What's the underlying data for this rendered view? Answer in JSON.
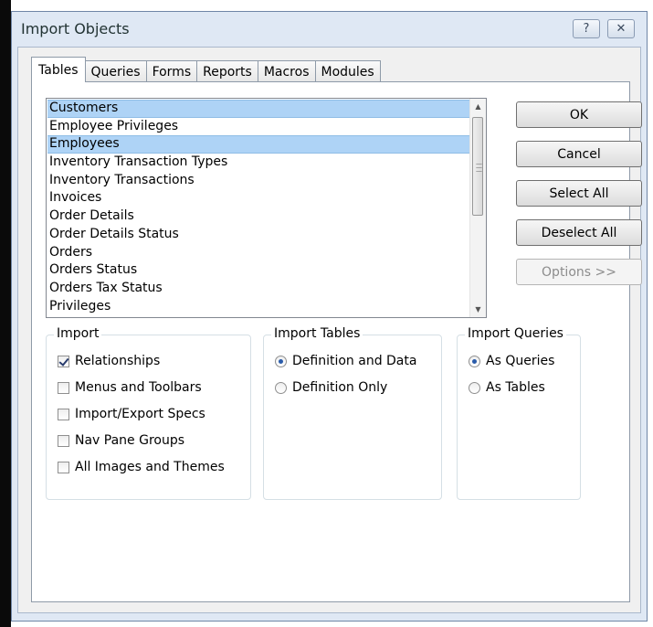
{
  "dialog": {
    "title": "Import Objects",
    "help_glyph": "?",
    "close_glyph": "✕"
  },
  "tabs": [
    {
      "label": "Tables",
      "active": true
    },
    {
      "label": "Queries",
      "active": false
    },
    {
      "label": "Forms",
      "active": false
    },
    {
      "label": "Reports",
      "active": false
    },
    {
      "label": "Macros",
      "active": false
    },
    {
      "label": "Modules",
      "active": false
    }
  ],
  "list": {
    "items": [
      {
        "label": "Customers",
        "selected": true
      },
      {
        "label": "Employee Privileges",
        "selected": false
      },
      {
        "label": "Employees",
        "selected": true
      },
      {
        "label": "Inventory Transaction Types",
        "selected": false
      },
      {
        "label": "Inventory Transactions",
        "selected": false
      },
      {
        "label": "Invoices",
        "selected": false
      },
      {
        "label": "Order Details",
        "selected": false
      },
      {
        "label": "Order Details Status",
        "selected": false
      },
      {
        "label": "Orders",
        "selected": false
      },
      {
        "label": "Orders Status",
        "selected": false
      },
      {
        "label": "Orders Tax Status",
        "selected": false
      },
      {
        "label": "Privileges",
        "selected": false
      }
    ]
  },
  "buttons": {
    "ok": "OK",
    "cancel": "Cancel",
    "select_all": "Select All",
    "deselect_all": "Deselect All",
    "options": "Options >>"
  },
  "import_group": {
    "title": "Import",
    "options": [
      {
        "label": "Relationships",
        "checked": true
      },
      {
        "label": "Menus and Toolbars",
        "checked": false
      },
      {
        "label": "Import/Export Specs",
        "checked": false
      },
      {
        "label": "Nav Pane Groups",
        "checked": false
      },
      {
        "label": "All Images and Themes",
        "checked": false
      }
    ]
  },
  "import_tables_group": {
    "title": "Import Tables",
    "options": [
      {
        "label": "Definition and Data",
        "selected": true
      },
      {
        "label": "Definition Only",
        "selected": false
      }
    ]
  },
  "import_queries_group": {
    "title": "Import Queries",
    "options": [
      {
        "label": "As Queries",
        "selected": true
      },
      {
        "label": "As Tables",
        "selected": false
      }
    ]
  }
}
